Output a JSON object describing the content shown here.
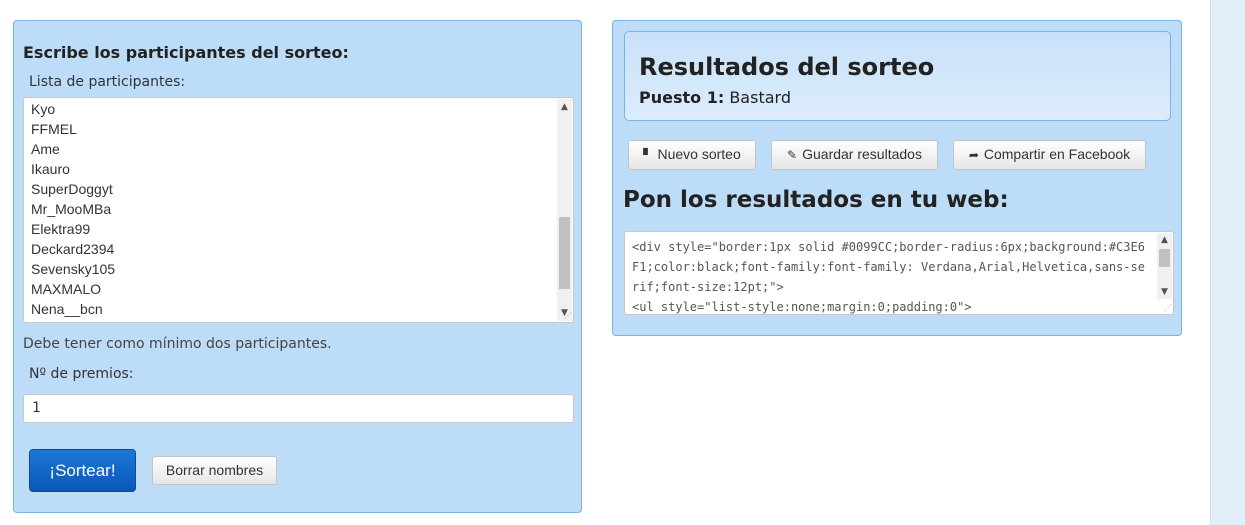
{
  "participants_panel": {
    "title": "Escribe los participantes del sorteo:",
    "list_label": "Lista de participantes:",
    "participants": [
      "Kyo",
      "FFMEL",
      "Ame",
      "Ikauro",
      "SuperDoggyt",
      "Mr_MooMBa",
      "Elektra99",
      "Deckard2394",
      "Sevensky105",
      "MAXMALO",
      "Nena__bcn"
    ],
    "hint": "Debe tener como mínimo dos participantes.",
    "prizes_label": "Nº de premios:",
    "prizes_value": "1",
    "draw_button": "¡Sortear!",
    "clear_button": "Borrar nombres"
  },
  "results_panel": {
    "title": "Resultados del sorteo",
    "result_position_label": "Puesto 1:",
    "result_winner": "Bastard",
    "new_draw_button": "Nuevo sorteo",
    "save_button": "Guardar resultados",
    "share_button": "Compartir en Facebook",
    "embed_title": "Pon los resultados en tu web:",
    "embed_code": "<div style=\"border:1px solid #0099CC;border-radius:6px;background:#C3E6F1;color:black;font-family:font-family: Verdana,Arial,Helvetica,sans-serif;font-size:12pt;\">\n<ul style=\"list-style:none;margin:0;padding:0\">"
  },
  "colors": {
    "panel_bg": "#bddcf8",
    "panel_border": "#79b3e3",
    "primary_button": "#0a57b7"
  },
  "icons": {
    "new_draw": "file-icon",
    "save": "edit-icon",
    "share": "share-arrow-icon"
  }
}
